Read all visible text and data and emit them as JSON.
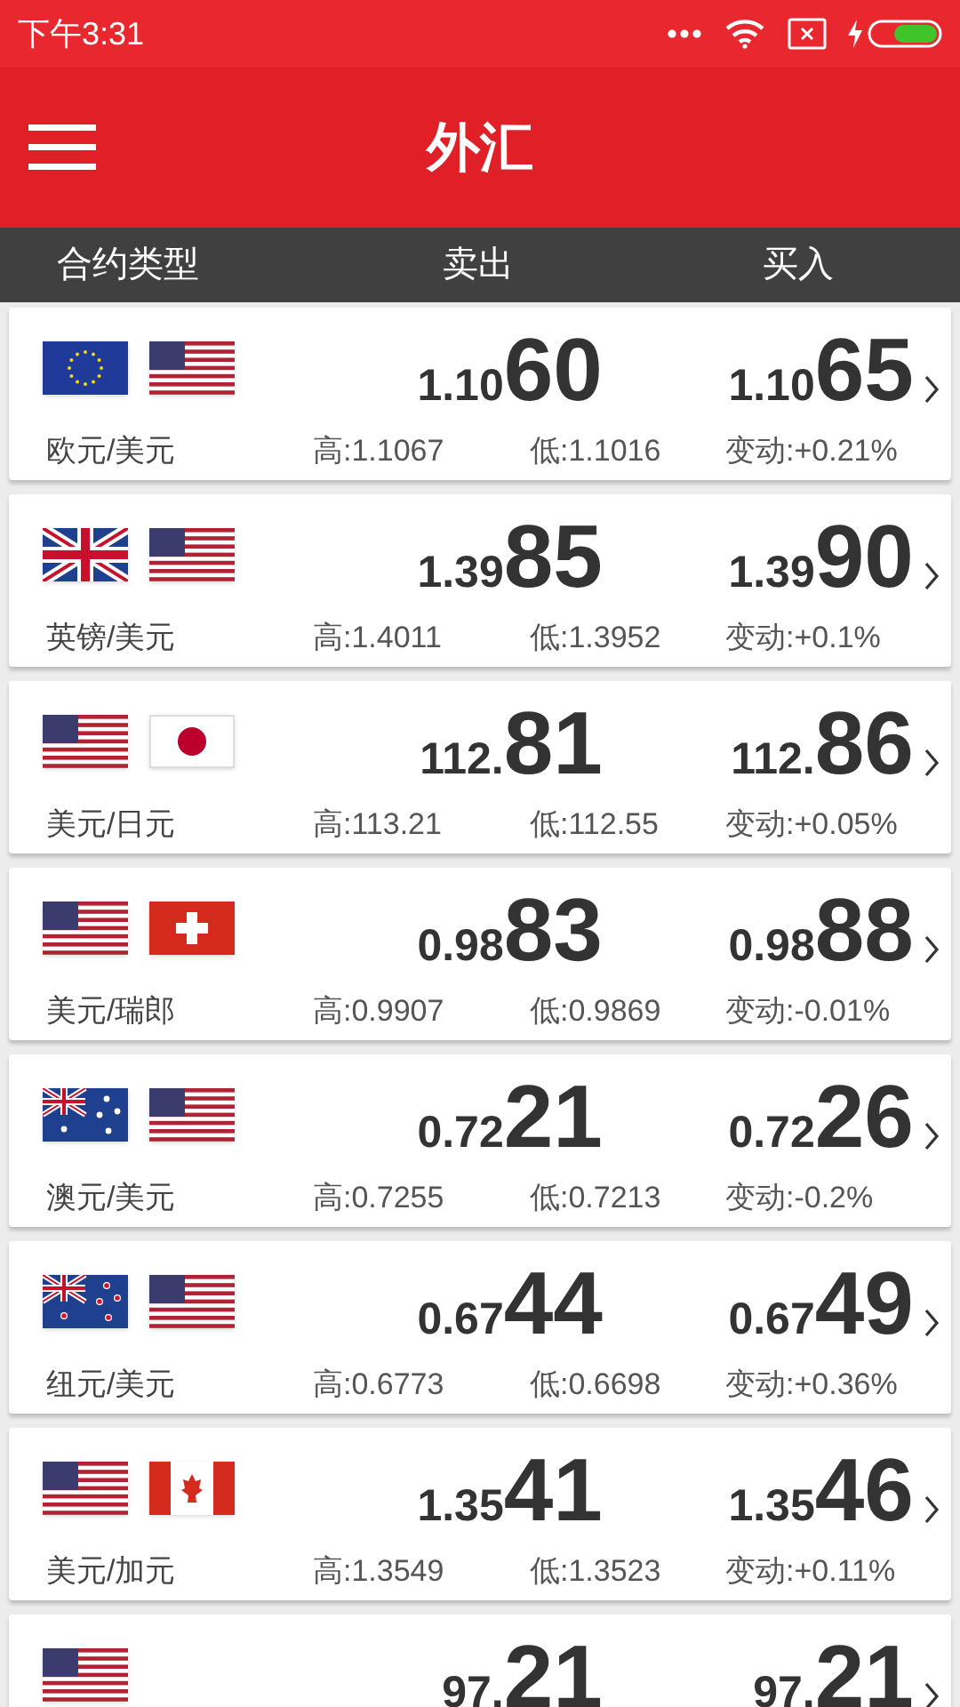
{
  "status_bar": {
    "time": "下午3:31"
  },
  "app_bar": {
    "title": "外汇"
  },
  "columns": [
    "合约类型",
    "卖出",
    "买入"
  ],
  "quotes": [
    {
      "flags": [
        {
          "kind": "eu"
        },
        {
          "kind": "us"
        }
      ],
      "pair": "欧元/美元",
      "sell": {
        "prefix": "1.10",
        "main": "60"
      },
      "buy": {
        "prefix": "1.10",
        "main": "65"
      },
      "high": "高:1.1067",
      "low": "低:1.1016",
      "change": "变动:+0.21%"
    },
    {
      "flags": [
        {
          "kind": "gb"
        },
        {
          "kind": "us"
        }
      ],
      "pair": "英镑/美元",
      "sell": {
        "prefix": "1.39",
        "main": "85"
      },
      "buy": {
        "prefix": "1.39",
        "main": "90"
      },
      "high": "高:1.4011",
      "low": "低:1.3952",
      "change": "变动:+0.1%"
    },
    {
      "flags": [
        {
          "kind": "us"
        },
        {
          "kind": "jp"
        }
      ],
      "pair": "美元/日元",
      "sell": {
        "prefix": "112.",
        "main": "81"
      },
      "buy": {
        "prefix": "112.",
        "main": "86"
      },
      "high": "高:113.21",
      "low": "低:112.55",
      "change": "变动:+0.05%"
    },
    {
      "flags": [
        {
          "kind": "us"
        },
        {
          "kind": "ch"
        }
      ],
      "pair": "美元/瑞郎",
      "sell": {
        "prefix": "0.98",
        "main": "83"
      },
      "buy": {
        "prefix": "0.98",
        "main": "88"
      },
      "high": "高:0.9907",
      "low": "低:0.9869",
      "change": "变动:-0.01%"
    },
    {
      "flags": [
        {
          "kind": "au"
        },
        {
          "kind": "us"
        }
      ],
      "pair": "澳元/美元",
      "sell": {
        "prefix": "0.72",
        "main": "21"
      },
      "buy": {
        "prefix": "0.72",
        "main": "26"
      },
      "high": "高:0.7255",
      "low": "低:0.7213",
      "change": "变动:-0.2%"
    },
    {
      "flags": [
        {
          "kind": "nz"
        },
        {
          "kind": "us"
        }
      ],
      "pair": "纽元/美元",
      "sell": {
        "prefix": "0.67",
        "main": "44"
      },
      "buy": {
        "prefix": "0.67",
        "main": "49"
      },
      "high": "高:0.6773",
      "low": "低:0.6698",
      "change": "变动:+0.36%"
    },
    {
      "flags": [
        {
          "kind": "us"
        },
        {
          "kind": "ca"
        }
      ],
      "pair": "美元/加元",
      "sell": {
        "prefix": "1.35",
        "main": "41"
      },
      "buy": {
        "prefix": "1.35",
        "main": "46"
      },
      "high": "高:1.3549",
      "low": "低:1.3523",
      "change": "变动:+0.11%"
    },
    {
      "flags": [
        {
          "kind": "us"
        }
      ],
      "sell": {
        "prefix": "97.",
        "main": "21"
      },
      "buy": {
        "prefix": "97.",
        "main": "21"
      }
    }
  ]
}
